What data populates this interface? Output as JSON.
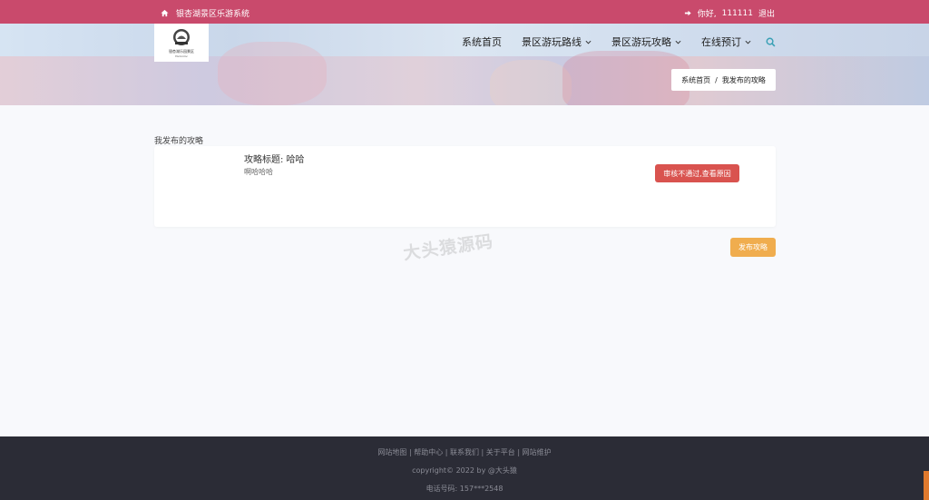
{
  "topbar": {
    "site_name": "银杏湖景区乐游系统",
    "greeting": "你好,",
    "username": "111111",
    "logout": "退出",
    "home_icon": "home-icon",
    "signin_icon": "sign-in-icon"
  },
  "logo": {
    "name": "银杏湖乐园景区",
    "tagline": "Welcome"
  },
  "nav": {
    "items": [
      {
        "label": "系统首页"
      },
      {
        "label": "景区游玩路线"
      },
      {
        "label": "景区游玩攻略"
      },
      {
        "label": "在线预订"
      }
    ]
  },
  "breadcrumb": {
    "home": "系统首页",
    "sep": "/",
    "current": "我发布的攻略"
  },
  "section": {
    "title": "我发布的攻略"
  },
  "guide": {
    "title": "攻略标题: 哈哈",
    "content": "啊哈哈哈",
    "status": "审核不通过,查看原因"
  },
  "actions": {
    "publish": "发布攻略"
  },
  "watermark": "大头猿源码",
  "footer": {
    "links": "网站地图 | 帮助中心 | 联系我们 | 关于平台 | 网站维护",
    "copyright": "copyright© 2022 by @大头猿",
    "phone": "电话号码:  157***2548"
  },
  "colors": {
    "topbar": "#c94a6c",
    "danger": "#d9534f",
    "warning": "#f0ad4e",
    "footer": "#2b2c36",
    "accent": "#3aa0b5"
  }
}
